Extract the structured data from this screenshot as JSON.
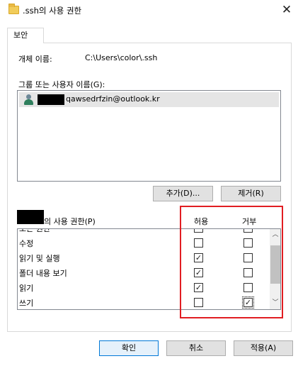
{
  "window": {
    "title": ".ssh의 사용 권한",
    "close_glyph": "✕"
  },
  "tabs": [
    {
      "label": "보안"
    }
  ],
  "object": {
    "label": "개체 이름:",
    "value": "C:\\Users\\color\\.ssh"
  },
  "groups": {
    "label": "그룹 또는 사용자 이름(G):",
    "items": [
      {
        "name": "qawsedrfzin@outlook.kr",
        "icon": "user-icon",
        "selected": true
      }
    ]
  },
  "buttons": {
    "add": "추가(D)...",
    "remove": "제거(R)",
    "ok": "확인",
    "cancel": "취소",
    "apply": "적용(A)"
  },
  "permissions": {
    "label": "의 사용 권한(P)",
    "allow_header": "허용",
    "deny_header": "거부",
    "rows": [
      {
        "name": "모든 권한",
        "allow": false,
        "deny": false
      },
      {
        "name": "수정",
        "allow": false,
        "deny": false
      },
      {
        "name": "읽기 및 실행",
        "allow": true,
        "deny": false
      },
      {
        "name": "폴더 내용 보기",
        "allow": true,
        "deny": false
      },
      {
        "name": "읽기",
        "allow": true,
        "deny": false
      },
      {
        "name": "쓰기",
        "allow": false,
        "deny": true
      }
    ]
  },
  "scrollbar": {
    "up_glyph": "︿",
    "down_glyph": "﹀"
  },
  "colors": {
    "highlight_border": "#e11d22",
    "selected_row": "#e5e5e5",
    "default_button_border": "#0078d7"
  }
}
